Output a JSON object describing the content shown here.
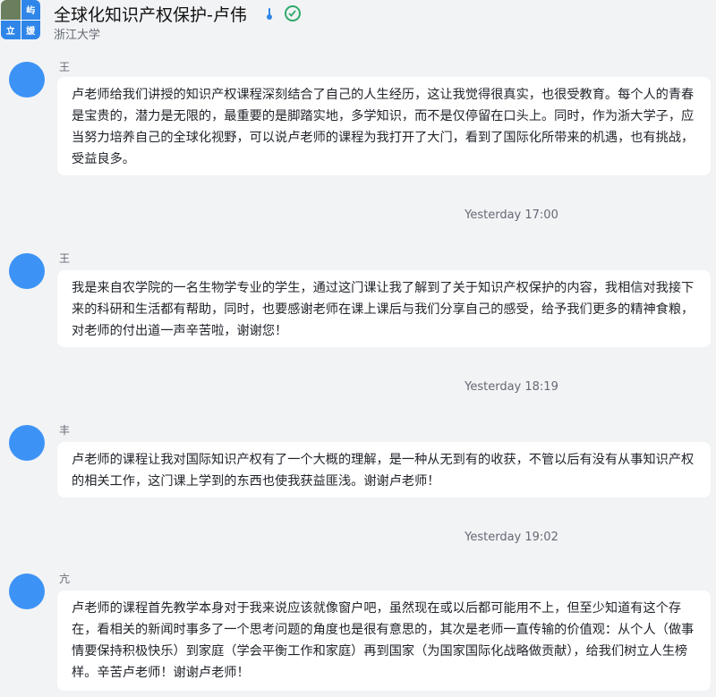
{
  "header": {
    "title": "全球化知识产权保护-卢伟",
    "subtitle": "浙江大学",
    "avatar_text": [
      "屿",
      "立",
      "媛"
    ],
    "icons": [
      "thermometer-icon",
      "verified-check-icon"
    ],
    "colors": {
      "accent": "#2f86e8",
      "verified": "#2eaa6b",
      "avatar": "#3c93f5"
    }
  },
  "messages": [
    {
      "sender": "王",
      "text": "卢老师给我们讲授的知识产权课程深刻结合了自己的人生经历，这让我觉得很真实，也很受教育。每个人的青春是宝贵的，潜力是无限的，最重要的是脚踏实地，多学知识，而不是仅停留在口头上。同时，作为浙大学子，应当努力培养自己的全球化视野，可以说卢老师的课程为我打开了大门，看到了国际化所带来的机遇，也有挑战，受益良多。"
    },
    {
      "timestamp": "Yesterday 17:00",
      "sender": "王",
      "text": "我是来自农学院的一名生物学专业的学生，通过这门课让我了解到了关于知识产权保护的内容，我相信对我接下来的科研和生活都有帮助，同时，也要感谢老师在课上课后与我们分享自己的感受，给予我们更多的精神食粮，对老师的付出道一声辛苦啦，谢谢您！"
    },
    {
      "timestamp": "Yesterday 18:19",
      "sender": "丰",
      "text": "卢老师的课程让我对国际知识产权有了一个大概的理解，是一种从无到有的收获，不管以后有没有从事知识产权的相关工作，这门课上学到的东西也使我获益匪浅。谢谢卢老师！"
    },
    {
      "timestamp": "Yesterday 19:02",
      "sender": "亢",
      "text": "卢老师的课程首先教学本身对于我来说应该就像窗户吧，虽然现在或以后都可能用不上，但至少知道有这个存在，看相关的新闻时事多了一个思考问题的角度也是很有意思的，其次是老师一直传输的价值观：从个人（做事情要保持积极快乐）到家庭（学会平衡工作和家庭）再到国家（为国家国际化战略做贡献），给我们树立人生榜样。辛苦卢老师！谢谢卢老师！"
    }
  ]
}
